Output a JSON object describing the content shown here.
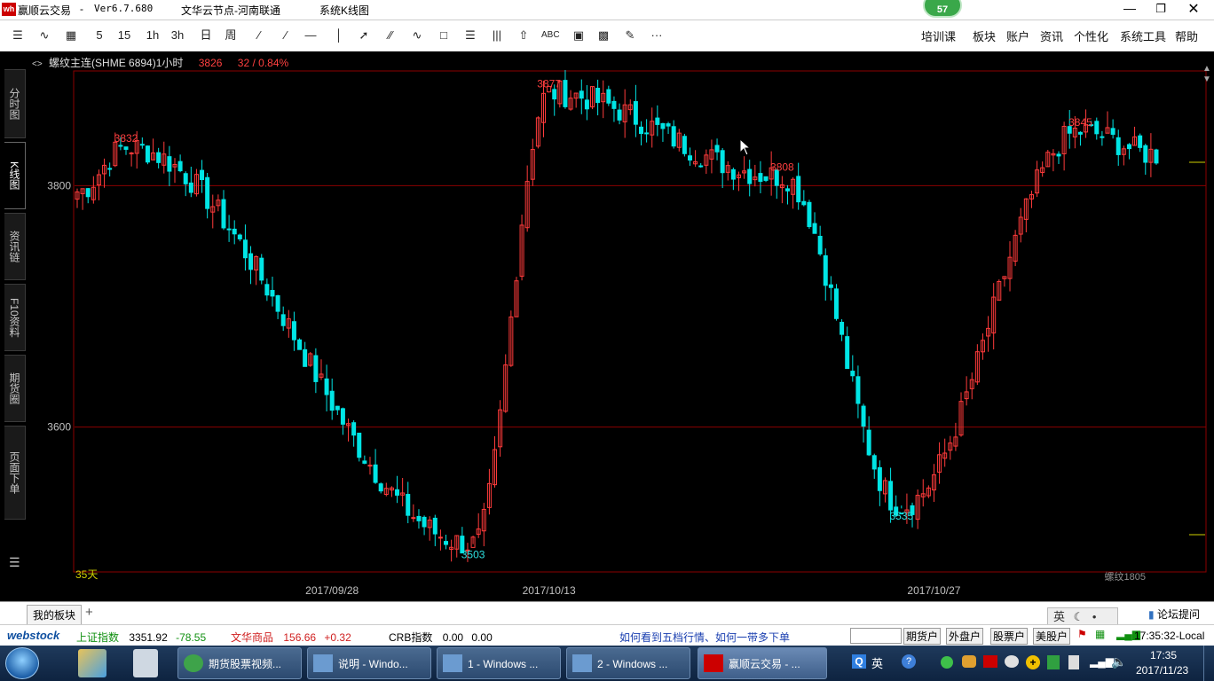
{
  "window": {
    "app_title": "赢顺云交易",
    "version": "Ver6.7.680",
    "node": "文华云节点-河南联通",
    "mode": "系统K线图",
    "badge_count": "57"
  },
  "toolbar": {
    "left_items": [
      "5",
      "15",
      "1h",
      "3h",
      "日",
      "周"
    ],
    "abc_label": "ABC",
    "more_label": "···",
    "menus": [
      "培训课",
      "板块",
      "账户",
      "资讯",
      "个性化",
      "系统工具",
      "帮助"
    ]
  },
  "side_tabs": [
    "分时图",
    "K线图",
    "资讯链",
    "F10资料",
    "期货圈",
    "页面下单"
  ],
  "chart_header": {
    "arrow": "<>",
    "symbol": "螺纹主连(SHME 6894)1小时",
    "price": "3826",
    "change": "32 / 0.84%"
  },
  "chart_labels": {
    "y_ticks": [
      "3800",
      "3600"
    ],
    "x_ticks": [
      "2017/09/28",
      "2017/10/13",
      "2017/10/27"
    ],
    "days": "35天",
    "contract": "螺纹1805",
    "peaks": [
      {
        "label": "3832",
        "type": "high"
      },
      {
        "label": "3877",
        "type": "high"
      },
      {
        "label": "3808",
        "type": "high"
      },
      {
        "label": "3845",
        "type": "high"
      },
      {
        "label": "3503",
        "type": "low"
      },
      {
        "label": "3535",
        "type": "low"
      }
    ]
  },
  "chart_data": {
    "type": "candlestick",
    "title": "螺纹主连(SHME 6894)1小时",
    "ylim": [
      3480,
      3895
    ],
    "y_ticks": [
      3800,
      3600
    ],
    "x_ticks": [
      "2017/09/28",
      "2017/10/13",
      "2017/10/27"
    ],
    "grid": true,
    "key_points": [
      {
        "x_index": 9,
        "value": 3832
      },
      {
        "x_index": 87,
        "value": 3877
      },
      {
        "x_index": 130,
        "value": 3808
      },
      {
        "x_index": 185,
        "value": 3845
      },
      {
        "x_index": 73,
        "value": 3503
      },
      {
        "x_index": 152,
        "value": 3535
      }
    ],
    "last_close": 3826,
    "change": 32,
    "change_pct": "0.84%"
  },
  "bottom_tabs": {
    "my_block": "我的板块",
    "add": "+",
    "forum": "论坛提问",
    "ime": "英"
  },
  "ticker": {
    "brand": "webstock",
    "items": [
      {
        "name": "上证指数",
        "value": "3351.92",
        "change": "-78.55"
      },
      {
        "name": "文华商品",
        "value": "156.66",
        "change": "+0.32"
      },
      {
        "name": "CRB指数",
        "value": "0.00",
        "change": "0.00"
      }
    ],
    "link": "如何看到五档行情、如何一带多下单",
    "accounts": [
      "期货户",
      "外盘户",
      "股票户",
      "美股户"
    ],
    "clock": "17:35:32-Local"
  },
  "taskbar": {
    "buttons": [
      "期货股票视频...",
      "说明 - Windo...",
      "1 - Windows ...",
      "2 - Windows ...",
      "赢顺云交易 - ..."
    ],
    "lang": "英",
    "time": "17:35",
    "date": "2017/11/23"
  },
  "colors": {
    "up": "#ff3b3b",
    "down": "#00e5e5",
    "grid": "#8b0000",
    "tick_text": "#c0c0c0",
    "high_label": "#ff4040",
    "low_label": "#2ee0e0"
  }
}
